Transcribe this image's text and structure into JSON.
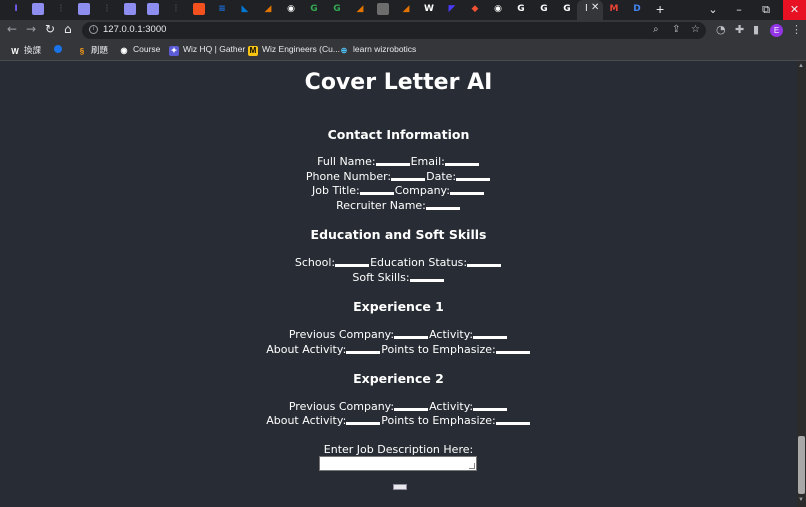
{
  "browser": {
    "active_tab_label": "I",
    "url": "127.0.0.1:3000",
    "bookmarks": [
      "換課",
      "刷題",
      "Course",
      "Wiz HQ | Gather",
      "Wiz Engineers (Cu...",
      "learn wizrobotics"
    ],
    "bookmark_letter": "W",
    "profile_initial": "E",
    "tab_icons": [
      {
        "glyph": "I",
        "color": "#7b61ff"
      },
      {
        "glyph": "",
        "color": "#8e8ef0"
      },
      {
        "glyph": "⋮",
        "color": "#3c3c3c"
      },
      {
        "glyph": "",
        "color": "#8e8ef0"
      },
      {
        "glyph": "⋮",
        "color": "#3c3c3c"
      },
      {
        "glyph": "",
        "color": "#8e8ef0"
      },
      {
        "glyph": "",
        "color": "#8e8ef0"
      },
      {
        "glyph": "⋮",
        "color": "#3c3c3c"
      },
      {
        "glyph": "",
        "color": "#f4511e"
      },
      {
        "glyph": "≡",
        "color": "#1a73e8"
      },
      {
        "glyph": "◣",
        "color": "#0078d4"
      },
      {
        "glyph": "◢",
        "color": "#e37400"
      },
      {
        "glyph": "◉",
        "color": "#ffffff"
      },
      {
        "glyph": "G",
        "color": "#34a853"
      },
      {
        "glyph": "G",
        "color": "#34a853"
      },
      {
        "glyph": "◢",
        "color": "#e37400"
      },
      {
        "glyph": "",
        "color": "#6d6d6d"
      },
      {
        "glyph": "◢",
        "color": "#e37400"
      },
      {
        "glyph": "W",
        "color": "#ffffff"
      },
      {
        "glyph": "◤",
        "color": "#4a3aff"
      },
      {
        "glyph": "◆",
        "color": "#f05033"
      },
      {
        "glyph": "◉",
        "color": "#ffffff"
      },
      {
        "glyph": "G",
        "color": "#ffffff"
      },
      {
        "glyph": "G",
        "color": "#ffffff"
      },
      {
        "glyph": "G",
        "color": "#ffffff"
      },
      {
        "glyph": "M",
        "color": "#ea4335"
      },
      {
        "glyph": "D",
        "color": "#4285f4"
      }
    ]
  },
  "app": {
    "title": "Cover Letter AI",
    "contact": {
      "heading": "Contact Information",
      "full_name": "Full Name:",
      "email": "Email:",
      "phone": "Phone Number:",
      "date": "Date:",
      "job_title": "Job Title:",
      "company": "Company:",
      "recruiter": "Recruiter Name:"
    },
    "education": {
      "heading": "Education and Soft Skills",
      "school": "School:",
      "status": "Education Status:",
      "soft_skills": "Soft Skills:"
    },
    "experience1": {
      "heading": "Experience 1",
      "prev_company": "Previous Company:",
      "activity": "Activity:",
      "about": "About Activity:",
      "points": "Points to Emphasize:"
    },
    "experience2": {
      "heading": "Experience 2",
      "prev_company": "Previous Company:",
      "activity": "Activity:",
      "about": "About Activity:",
      "points": "Points to Emphasize:"
    },
    "job_description_label": "Enter Job Description Here:",
    "job_description_value": "",
    "submit_label": ""
  },
  "colors": {
    "page_bg": "#282c34",
    "text": "#ffffff",
    "chrome_dark": "#202124",
    "chrome_mid": "#35363a"
  }
}
